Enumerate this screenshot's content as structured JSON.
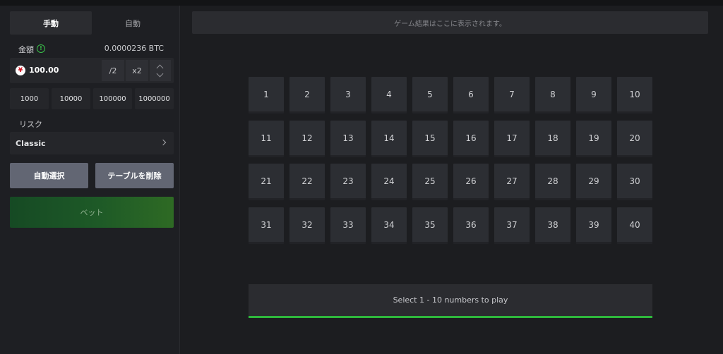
{
  "mode_tabs": {
    "manual": "手動",
    "auto": "自動"
  },
  "amount": {
    "label": "金額",
    "info_icon_symbol": "!",
    "btc_equivalent": "0.0000236 BTC",
    "currency_symbol": "¥",
    "value": "100.00",
    "half_label": "/2",
    "double_label": "x2"
  },
  "presets": [
    "1000",
    "10000",
    "100000",
    "1000000"
  ],
  "risk": {
    "label": "リスク",
    "selected": "Classic"
  },
  "actions": {
    "auto_pick": "自動選択",
    "clear_table": "テーブルを削除",
    "bet": "ベット"
  },
  "result_message": "ゲーム結果はここに表示されます。",
  "board": {
    "numbers": [
      "1",
      "2",
      "3",
      "4",
      "5",
      "6",
      "7",
      "8",
      "9",
      "10",
      "11",
      "12",
      "13",
      "14",
      "15",
      "16",
      "17",
      "18",
      "19",
      "20",
      "21",
      "22",
      "23",
      "24",
      "25",
      "26",
      "27",
      "28",
      "29",
      "30",
      "31",
      "32",
      "33",
      "34",
      "35",
      "36",
      "37",
      "38",
      "39",
      "40"
    ],
    "columns": 10
  },
  "info_message": "Select 1 - 10 numbers to play",
  "colors": {
    "accent_green": "#2fb83c",
    "bet_button": "#1e5a27",
    "action_button": "#626673",
    "yen_icon": "#d0101d"
  }
}
